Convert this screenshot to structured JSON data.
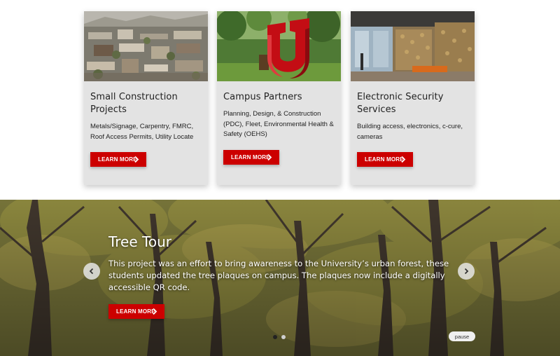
{
  "cards": [
    {
      "title": "Small Construction Projects",
      "description": "Metals/Signage, Carpentry, FMRC, Roof Access Permits, Utility Locate",
      "button_label": "LEARN MORE",
      "image": "campus-aerial-photo"
    },
    {
      "title": "Campus Partners",
      "description": "Planning, Design, & Construction (PDC), Fleet, Environmental Health & Safety (OEHS)",
      "button_label": "LEARN MORE",
      "image": "block-u-sculpture-photo"
    },
    {
      "title": "Electronic Security Services",
      "description": "Building access, electronics, c-cure, cameras",
      "button_label": "LEARN MORE",
      "image": "building-lobby-photo"
    }
  ],
  "carousel": {
    "title": "Tree Tour",
    "text": "This project was an effort to bring awareness to the University’s urban forest, these students updated the tree plaques on campus. The plaques now include a digitally accessible QR code.",
    "button_label": "LEARN MORE",
    "pause_label": "pause",
    "slide_count": 2,
    "active_slide": 1,
    "prev_icon": "chevron-left-icon",
    "next_icon": "chevron-right-icon",
    "background": "campus-trees-photo"
  },
  "colors": {
    "accent": "#cc0000",
    "card_bg": "#e3e3e3",
    "text": "#222222"
  }
}
